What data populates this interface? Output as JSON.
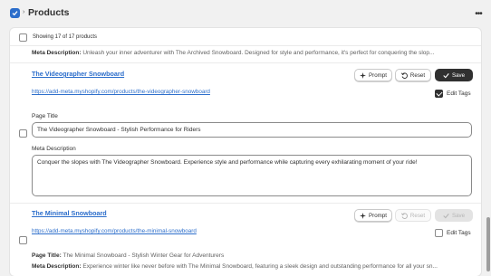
{
  "header": {
    "title": "Products",
    "app_icon": "app-checkbox-icon",
    "more_icon": "ellipsis-icon"
  },
  "list": {
    "count_text": "Showing 17 of 17 products"
  },
  "prev_item": {
    "meta_label": "Meta Description:",
    "meta_value": "Unleash your inner adventurer with The Archived Snowboard. Designed for style and performance, it's perfect for conquering the slop..."
  },
  "item1": {
    "title": "The Videographer Snowboard",
    "url": "https://add-meta.myshopify.com/products/the-videographer-snowboard",
    "prompt_label": "Prompt",
    "reset_label": "Reset",
    "save_label": "Save",
    "edit_tags_label": "Edit Tags",
    "edit_tags_checked": true,
    "page_title_label": "Page Title",
    "page_title_value": "The Videographer Snowboard - Stylish Performance for Riders",
    "meta_desc_label": "Meta Description",
    "meta_desc_value": "Conquer the slopes with The Videographer Snowboard. Experience style and performance while capturing every exhilarating moment of your ride!"
  },
  "item2": {
    "title": "The Minimal Snowboard",
    "url": "https://add-meta.myshopify.com/products/the-minimal-snowboard",
    "prompt_label": "Prompt",
    "reset_label": "Reset",
    "save_label": "Save",
    "edit_tags_label": "Edit Tags",
    "edit_tags_checked": false,
    "page_title_label": "Page Title:",
    "page_title_value": "The Minimal Snowboard - Stylish Winter Gear for Adventurers",
    "meta_desc_label": "Meta Description:",
    "meta_desc_value": "Experience winter like never before with The Minimal Snowboard, featuring a sleek design and outstanding performance for all your sn..."
  },
  "colors": {
    "accent": "#2c6ecb",
    "primary_button": "#303030",
    "surface": "#ffffff",
    "page_bg": "#f1f1f1"
  }
}
